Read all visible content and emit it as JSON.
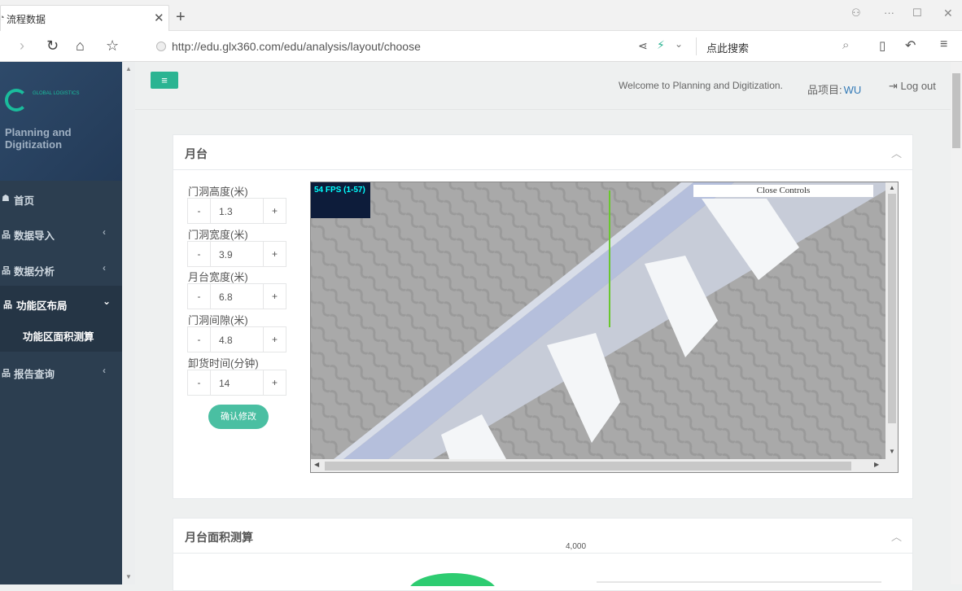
{
  "browser": {
    "tab_title": "流程数据",
    "new_tab": "+",
    "url": "http://edu.glx360.com/edu/analysis/layout/choose",
    "search_placeholder": "点此搜索"
  },
  "sidebar": {
    "logo_text": "GLOBAL LOGISTICS",
    "brand": "Planning and Digitization",
    "items": [
      {
        "label": "首页",
        "icon": "home-icon"
      },
      {
        "label": "数据导入",
        "icon": "sitemap-icon"
      },
      {
        "label": "数据分析",
        "icon": "sitemap-icon"
      },
      {
        "label": "功能区布局",
        "icon": "sitemap-icon"
      },
      {
        "label": "报告查询",
        "icon": "sitemap-icon"
      }
    ],
    "subitem": "功能区面积测算"
  },
  "header": {
    "welcome": "Welcome to Planning and Digitization.",
    "project_label": "项目:",
    "project_value": "WU",
    "logout": "Log out"
  },
  "panel1": {
    "title": "月台",
    "fields": [
      {
        "label": "门洞高度(米)",
        "value": "1.3"
      },
      {
        "label": "门洞宽度(米)",
        "value": "3.9"
      },
      {
        "label": "月台宽度(米)",
        "value": "6.8"
      },
      {
        "label": "门洞间隙(米)",
        "value": "4.8"
      },
      {
        "label": "卸货时间(分钟)",
        "value": "14"
      }
    ],
    "minus": "-",
    "plus": "+",
    "confirm": "确认修改",
    "fps": "54 FPS (1-57)",
    "close_controls": "Close Controls"
  },
  "panel2": {
    "title": "月台面积测算",
    "tick": "4,000"
  },
  "colors": {
    "accent": "#2bb492",
    "sidebar": "#2c3e50"
  }
}
